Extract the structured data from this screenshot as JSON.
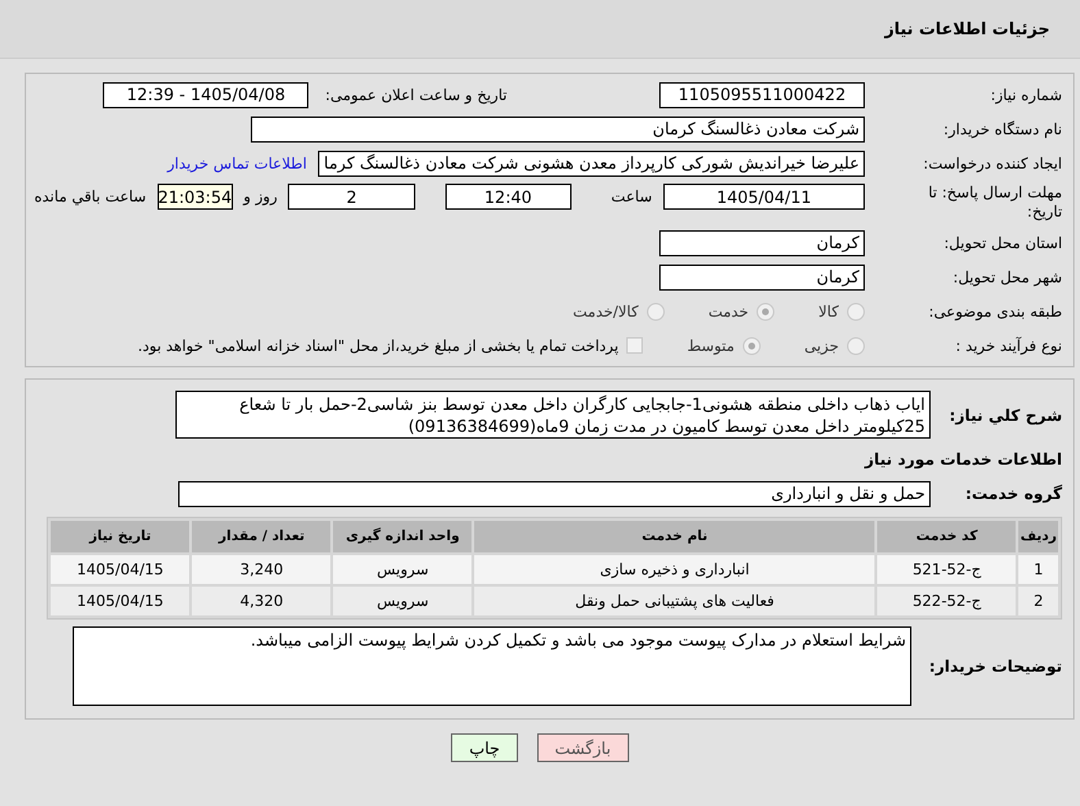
{
  "header": {
    "title": "جزئیات اطلاعات نیاز"
  },
  "need_number": {
    "label": "شماره نیاز:",
    "value": "1105095511000422"
  },
  "announce": {
    "label": "تاریخ و ساعت اعلان عمومی:",
    "value": "1405/04/08 - 12:39"
  },
  "buyer": {
    "label": "نام دستگاه خریدار:",
    "value": "شرکت معادن ذغالسنگ کرمان"
  },
  "creator": {
    "label": "ایجاد کننده درخواست:",
    "value": "علیرضا خیراندیش شورکی کارپرداز معدن هشونی شرکت معادن ذغالسنگ کرما",
    "link": "اطلاعات تماس خریدار"
  },
  "deadline": {
    "label": "مهلت ارسال پاسخ: تا تاریخ:",
    "date": "1405/04/11",
    "time_label": "ساعت",
    "time": "12:40",
    "days": "2",
    "days_label": "روز و",
    "remaining": "21:03:54",
    "remaining_label": "ساعت باقي مانده"
  },
  "province": {
    "label": "استان محل تحویل:",
    "value": "کرمان"
  },
  "city": {
    "label": "شهر محل تحویل:",
    "value": "کرمان"
  },
  "category": {
    "label": "طبقه بندی موضوعی:",
    "options": [
      {
        "label": "کالا",
        "selected": false
      },
      {
        "label": "خدمت",
        "selected": true
      },
      {
        "label": "کالا/خدمت",
        "selected": false
      }
    ]
  },
  "process": {
    "label": "نوع فرآیند خرید :",
    "options": [
      {
        "label": "جزیی",
        "selected": false
      },
      {
        "label": "متوسط",
        "selected": true
      }
    ],
    "treasury": {
      "label": "پرداخت تمام یا بخشی از مبلغ خرید،از محل \"اسناد خزانه اسلامی\" خواهد بود.",
      "checked": false
    }
  },
  "description": {
    "label": "شرح کلي نیاز:",
    "value": "ایاب ذهاب داخلی منطقه هشونی1-جابجایی کارگران داخل معدن توسط بنز شاسی2-حمل بار تا شعاع 25کیلومتر داخل معدن توسط کامیون در مدت زمان 9ماه(09136384699)"
  },
  "services_heading": "اطلاعات خدمات مورد نیاز",
  "service_group": {
    "label": "گروه خدمت:",
    "value": "حمل و نقل و انبارداری"
  },
  "table": {
    "columns": [
      "ردیف",
      "کد خدمت",
      "نام خدمت",
      "واحد اندازه گیری",
      "تعداد / مقدار",
      "تاریخ نیاز"
    ],
    "rows": [
      [
        "1",
        "ج-52-521",
        "انبارداری و ذخیره سازی",
        "سرویس",
        "3,240",
        "1405/04/15"
      ],
      [
        "2",
        "ج-52-522",
        "فعالیت های پشتیبانی حمل ونقل",
        "سرویس",
        "4,320",
        "1405/04/15"
      ]
    ]
  },
  "buyer_notes": {
    "label": "توضیحات خریدار:",
    "value": "شرایط استعلام در مدارک پیوست موجود می باشد و تکمیل کردن شرایط پیوست الزامی میباشد."
  },
  "buttons": [
    {
      "label": "بازگشت",
      "kind": "back"
    },
    {
      "label": "چاپ",
      "kind": "print"
    }
  ]
}
